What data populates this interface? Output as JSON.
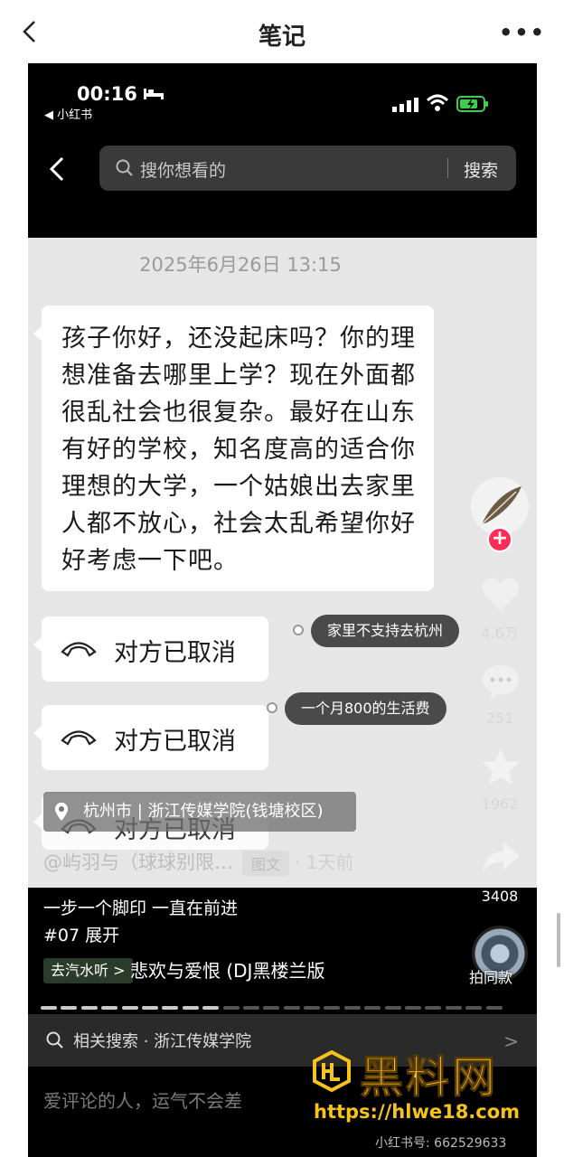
{
  "header": {
    "title": "笔记",
    "more": "•••"
  },
  "status": {
    "time": "00:16",
    "back_app": "◀ 小红书"
  },
  "search": {
    "placeholder": "搜你想看的",
    "button": "搜索"
  },
  "chat": {
    "timestamp": "2025年6月26日 13:15",
    "message": "孩子你好，还没起床吗？你的理想准备去哪里上学？现在外面都很乱社会也很复杂。最好在山东有好的学校，知名度高的适合你理想的大学，一个姑娘出去家里人都不放心，社会太乱希望你好好考虑一下吧。",
    "calls": [
      "对方已取消",
      "对方已取消",
      "对方已取消"
    ]
  },
  "overlay_pills": [
    "家里不支持去杭州",
    "一个月800的生活费"
  ],
  "location": "杭州市 | 浙江传媒学院(钱塘校区)",
  "author": {
    "name": "@屿羽与（球球别限…",
    "badge": "图文",
    "ago": "· 1天前"
  },
  "actions": {
    "likes": "4.6万",
    "comments": "251",
    "stars": "1962",
    "shares": "3408"
  },
  "caption": {
    "line1": "一步一个脚印 一直在前进",
    "line2": "#07 展开"
  },
  "music": {
    "tag": "去汽水听 >",
    "title": "悲欢与爱恨 (DJ黑楼兰版",
    "same_style": "拍同款"
  },
  "progress": {
    "segments": 24,
    "current": 9
  },
  "related": {
    "text": "相关搜索 · 浙江传媒学院",
    "arrow": ">"
  },
  "comment_prompt": "爱评论的人，运气不会差",
  "redbook_id": "小红书号: 662529633",
  "watermark": {
    "title": "黑料网",
    "url": "https://hlwe18.com"
  },
  "colors": {
    "accent_red": "#ff2d55",
    "watermark_gold": "#f7c21a",
    "battery_green": "#3ccf4e"
  }
}
